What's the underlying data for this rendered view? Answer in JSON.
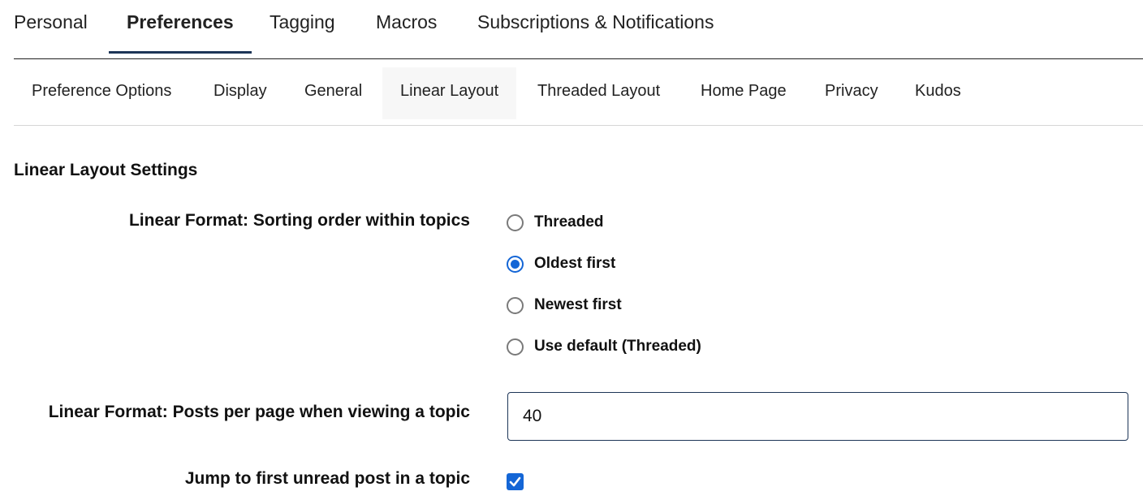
{
  "top_tabs": [
    {
      "label": "Personal"
    },
    {
      "label": "Preferences"
    },
    {
      "label": "Tagging"
    },
    {
      "label": "Macros"
    },
    {
      "label": "Subscriptions & Notifications"
    }
  ],
  "top_tabs_active": "Preferences",
  "sub_tabs": [
    {
      "label": "Preference Options"
    },
    {
      "label": "Display"
    },
    {
      "label": "General"
    },
    {
      "label": "Linear Layout"
    },
    {
      "label": "Threaded Layout"
    },
    {
      "label": "Home Page"
    },
    {
      "label": "Privacy"
    },
    {
      "label": "Kudos"
    }
  ],
  "sub_tabs_active": "Linear Layout",
  "section": {
    "title": "Linear Layout Settings"
  },
  "sorting": {
    "label": "Linear Format: Sorting order within topics",
    "options": [
      {
        "label": "Threaded"
      },
      {
        "label": "Oldest first"
      },
      {
        "label": "Newest first"
      },
      {
        "label": "Use default (Threaded)"
      }
    ],
    "selected": "Oldest first"
  },
  "posts_per_page": {
    "label": "Linear Format: Posts per page when viewing a topic",
    "value": "40"
  },
  "jump_unread": {
    "label": "Jump to first unread post in a topic",
    "checked": true
  },
  "colors": {
    "accent": "#1466d6",
    "active_tab_underline": "#1d3557"
  }
}
